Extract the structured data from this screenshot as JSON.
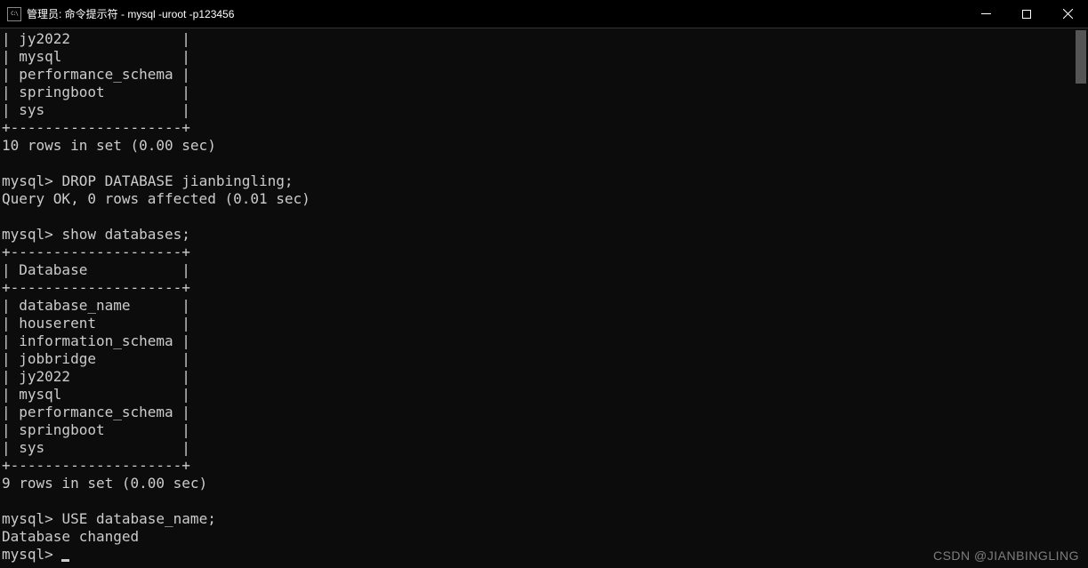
{
  "window": {
    "title": "管理员: 命令提示符 - mysql  -uroot -p123456",
    "icon_label": "C:\\"
  },
  "terminal": {
    "partial_rows": [
      "| jy2022             |",
      "| mysql              |",
      "| performance_schema |",
      "| springboot         |",
      "| sys                |",
      "+--------------------+"
    ],
    "result1": "10 rows in set (0.00 sec)",
    "blank1": "",
    "prompt1": "mysql> ",
    "cmd1": "DROP DATABASE jianbingling;",
    "response1": "Query OK, 0 rows affected (0.01 sec)",
    "blank2": "",
    "prompt2": "mysql> ",
    "cmd2": "show databases;",
    "table_top": "+--------------------+",
    "table_header": "| Database           |",
    "table_sep": "+--------------------+",
    "db_rows": [
      "| database_name      |",
      "| houserent          |",
      "| information_schema |",
      "| jobbridge          |",
      "| jy2022             |",
      "| mysql              |",
      "| performance_schema |",
      "| springboot         |",
      "| sys                |"
    ],
    "table_bottom": "+--------------------+",
    "result2": "9 rows in set (0.00 sec)",
    "blank3": "",
    "prompt3": "mysql> ",
    "cmd3": "USE database_name;",
    "response3": "Database changed",
    "prompt4": "mysql> "
  },
  "watermark": "CSDN @JIANBINGLING"
}
